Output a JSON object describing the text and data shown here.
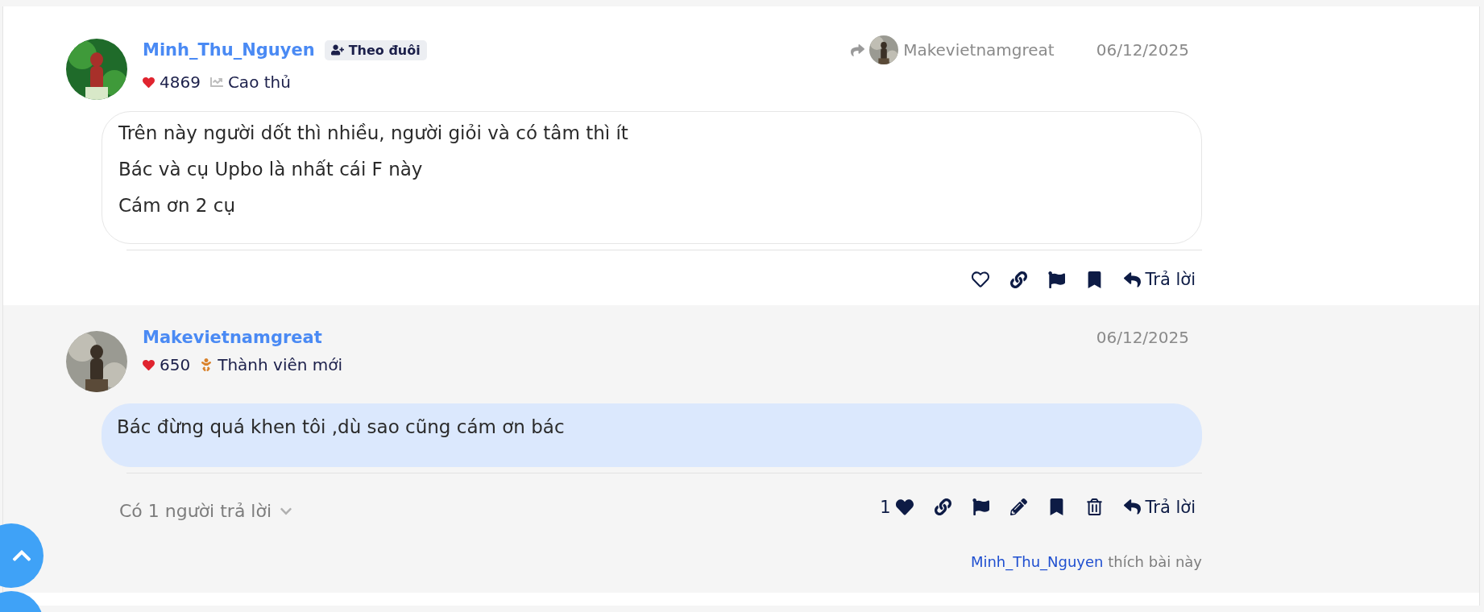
{
  "posts": [
    {
      "author": "Minh_Thu_Nguyen",
      "follow": {
        "label": "Theo đuôi"
      },
      "likes": "4869",
      "rank": {
        "kind": "expert",
        "label": "Cao thủ"
      },
      "reply_to": {
        "name": "Makevietnamgreat"
      },
      "date": "06/12/2025",
      "highlighted": false,
      "lines": [
        "Trên này người dốt thì nhiều, người giỏi và có tâm thì ít",
        "Bác và cụ Upbo là nhất cái F này",
        "Cám ơn 2 cụ"
      ],
      "actions": [
        {
          "kind": "like",
          "liked": false
        },
        {
          "kind": "link"
        },
        {
          "kind": "flag"
        },
        {
          "kind": "bookmark"
        },
        {
          "kind": "reply",
          "label": "Trả lời"
        }
      ]
    },
    {
      "author": "Makevietnamgreat",
      "likes": "650",
      "rank": {
        "kind": "newbie",
        "label": "Thành viên mới"
      },
      "date": "06/12/2025",
      "highlighted": true,
      "lines": [
        "Bác đừng quá khen tôi ,dù sao cũng cám ơn bác"
      ],
      "replies": {
        "label": "Có 1 người trả lời",
        "expanded": false
      },
      "actions": [
        {
          "kind": "like",
          "liked": true,
          "count": "1"
        },
        {
          "kind": "link"
        },
        {
          "kind": "flag"
        },
        {
          "kind": "edit"
        },
        {
          "kind": "bookmark"
        },
        {
          "kind": "delete"
        },
        {
          "kind": "reply",
          "label": "Trả lời"
        }
      ],
      "liked_by": {
        "name": "Minh_Thu_Nguyen",
        "text": "thích bài này"
      }
    }
  ]
}
